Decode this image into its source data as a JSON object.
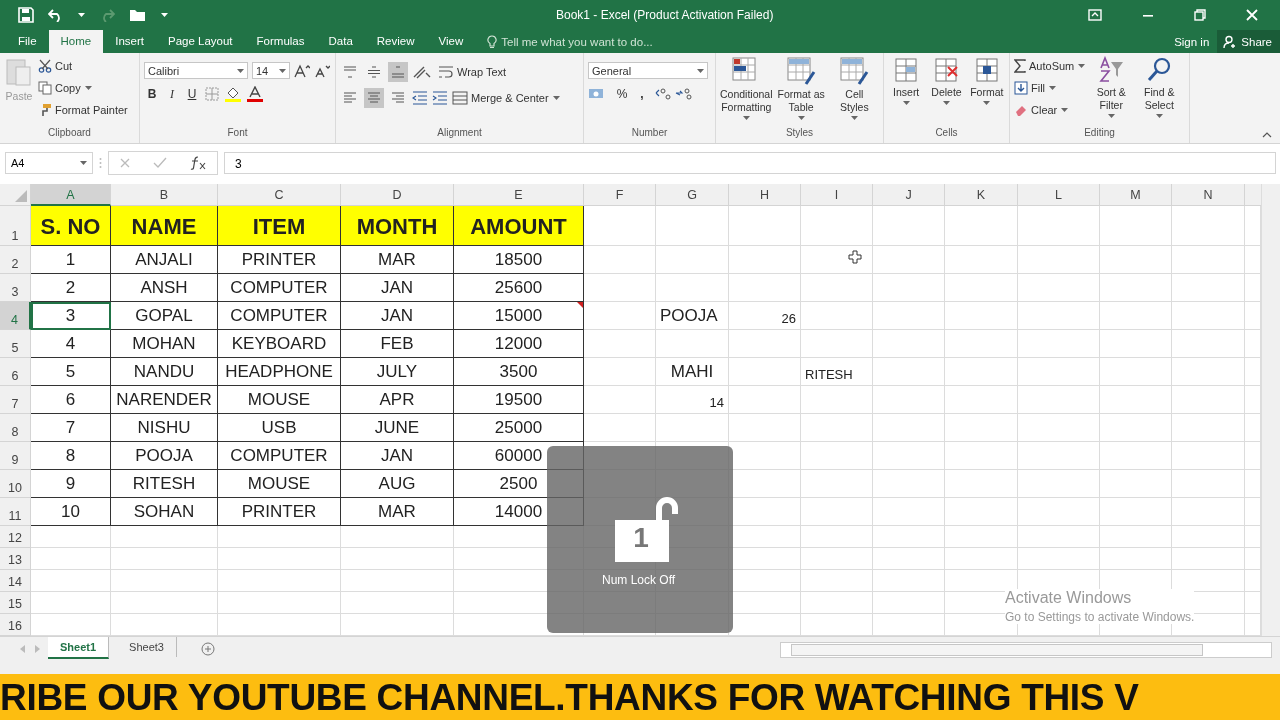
{
  "window": {
    "title": "Book1 - Excel (Product Activation Failed)"
  },
  "menu_tabs": [
    {
      "label": "File",
      "selected": false
    },
    {
      "label": "Home",
      "selected": true
    },
    {
      "label": "Insert",
      "selected": false
    },
    {
      "label": "Page Layout",
      "selected": false
    },
    {
      "label": "Formulas",
      "selected": false
    },
    {
      "label": "Data",
      "selected": false
    },
    {
      "label": "Review",
      "selected": false
    },
    {
      "label": "View",
      "selected": false
    }
  ],
  "tell_me": {
    "placeholder": "Tell me what you want to do..."
  },
  "sign_in": "Sign in",
  "share": "Share",
  "ribbon": {
    "clipboard": {
      "label": "Clipboard",
      "paste": {
        "label": "Paste",
        "disabled": true
      },
      "cut": "Cut",
      "copy": "Copy",
      "format_painter": "Format Painter"
    },
    "font": {
      "label": "Font",
      "font_name": "Calibri",
      "font_size": "14",
      "bold": "B",
      "italic": "I",
      "underline": "U"
    },
    "alignment": {
      "label": "Alignment",
      "wrap_text": "Wrap Text",
      "merge_center": "Merge & Center",
      "vertical_buttons": [
        {
          "selected": false
        },
        {
          "selected": false
        },
        {
          "selected": true
        }
      ],
      "horizontal_buttons": [
        {
          "selected": false
        },
        {
          "selected": true
        },
        {
          "selected": false
        }
      ]
    },
    "number": {
      "label": "Number",
      "format": "General",
      "percent": "%",
      "comma": ","
    },
    "styles": {
      "label": "Styles",
      "buttons": [
        "Conditional Formatting",
        "Format as Table",
        "Cell Styles"
      ]
    },
    "cells": {
      "label": "Cells",
      "buttons": [
        "Insert",
        "Delete",
        "Format"
      ]
    },
    "editing": {
      "label": "Editing",
      "autosum": "AutoSum",
      "fill": "Fill",
      "clear": "Clear",
      "sort_filter": "Sort & Filter",
      "find_select": "Find & Select"
    }
  },
  "name_box": "A4",
  "formula": "3",
  "columns": [
    {
      "label": "A",
      "selected": true
    },
    {
      "label": "B",
      "selected": false
    },
    {
      "label": "C",
      "selected": false
    },
    {
      "label": "D",
      "selected": false
    },
    {
      "label": "E",
      "selected": false
    },
    {
      "label": "F",
      "selected": false
    },
    {
      "label": "G",
      "selected": false
    },
    {
      "label": "H",
      "selected": false
    },
    {
      "label": "I",
      "selected": false
    },
    {
      "label": "J",
      "selected": false
    },
    {
      "label": "K",
      "selected": false
    },
    {
      "label": "L",
      "selected": false
    },
    {
      "label": "M",
      "selected": false
    },
    {
      "label": "N",
      "selected": false
    }
  ],
  "rows": [
    {
      "label": "1",
      "kind": "header",
      "selected": false,
      "cells": [
        "S. NO",
        "NAME",
        "ITEM",
        "MONTH",
        "AMOUNT"
      ]
    },
    {
      "label": "2",
      "kind": "data",
      "selected": false,
      "cells": [
        "1",
        "ANJALI",
        "PRINTER",
        "MAR",
        "18500"
      ]
    },
    {
      "label": "3",
      "kind": "data",
      "selected": false,
      "cells": [
        "2",
        "ANSH",
        "COMPUTER",
        "JAN",
        "25600"
      ]
    },
    {
      "label": "4",
      "kind": "data",
      "selected": true,
      "cells": [
        "3",
        "GOPAL",
        "COMPUTER",
        "JAN",
        "15000"
      ],
      "comment_on_amount": true,
      "column_g": {
        "text": "POOJA",
        "kind": "label"
      },
      "column_h": {
        "text": "26",
        "kind": "number"
      }
    },
    {
      "label": "5",
      "kind": "data",
      "selected": false,
      "cells": [
        "4",
        "MOHAN",
        "KEYBOARD",
        "FEB",
        "12000"
      ]
    },
    {
      "label": "6",
      "kind": "data",
      "selected": false,
      "cells": [
        "5",
        "NANDU",
        "HEADPHONE",
        "JULY",
        "3500"
      ],
      "column_g": {
        "text": "MAHI",
        "kind": "centered_label"
      },
      "column_i": {
        "text": "RITESH",
        "kind": "note"
      }
    },
    {
      "label": "7",
      "kind": "data",
      "selected": false,
      "cells": [
        "6",
        "NARENDER",
        "MOUSE",
        "APR",
        "19500"
      ],
      "column_g": {
        "text": "14",
        "kind": "number"
      }
    },
    {
      "label": "8",
      "kind": "data",
      "selected": false,
      "cells": [
        "7",
        "NISHU",
        "USB",
        "JUNE",
        "25000"
      ]
    },
    {
      "label": "9",
      "kind": "data",
      "selected": false,
      "cells": [
        "8",
        "POOJA",
        "COMPUTER",
        "JAN",
        "60000"
      ]
    },
    {
      "label": "10",
      "kind": "data",
      "selected": false,
      "cells": [
        "9",
        "RITESH",
        "MOUSE",
        "AUG",
        "2500"
      ]
    },
    {
      "label": "11",
      "kind": "data",
      "selected": false,
      "cells": [
        "10",
        "SOHAN",
        "PRINTER",
        "MAR",
        "14000"
      ]
    },
    {
      "label": "12",
      "kind": "empty",
      "selected": false
    },
    {
      "label": "13",
      "kind": "empty",
      "selected": false
    },
    {
      "label": "14",
      "kind": "empty",
      "selected": false
    },
    {
      "label": "15",
      "kind": "empty",
      "selected": false
    },
    {
      "label": "16",
      "kind": "empty",
      "selected": false
    }
  ],
  "sheet_tabs": [
    {
      "label": "Sheet1",
      "selected": true
    },
    {
      "label": "Sheet3",
      "selected": false
    }
  ],
  "num_lock_popup": {
    "key_digit": "1",
    "message": "Num Lock Off"
  },
  "activation_notice": {
    "title": "Activate Windows",
    "detail": "Go to Settings to activate Windows."
  },
  "banner": "RIBE OUR YOUTUBE CHANNEL.THANKS FOR WATCHING THIS V"
}
